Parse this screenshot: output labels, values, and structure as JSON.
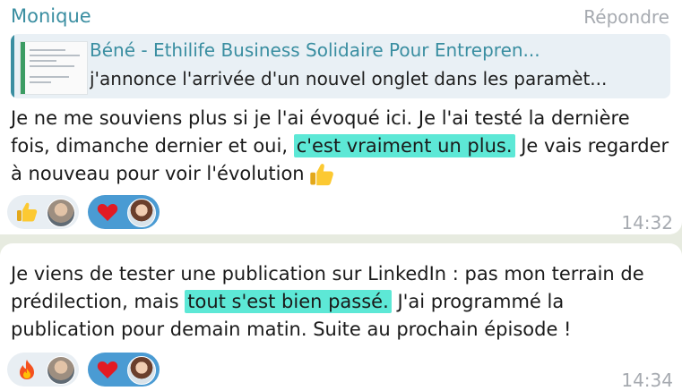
{
  "messages": [
    {
      "author": "Monique",
      "reply_action": "Répondre",
      "quote": {
        "title": "Béné - Ethilife Business Solidaire Pour Entrepren...",
        "text": "j'annonce l'arrivée d'un nouvel onglet dans les paramèt..."
      },
      "text_before": "Je ne me souviens plus si je l'ai évoqué ici. Je l'ai testé la dernière fois, dimanche dernier et oui, ",
      "highlight": "c'est vraiment un plus.",
      "text_after": " Je vais regarder à nouveau pour voir l'évolution",
      "trailing_emoji": "thumbs-up",
      "reactions": [
        {
          "emoji": "thumbs-up",
          "reactor": "man-avatar",
          "mine": false
        },
        {
          "emoji": "red-heart",
          "reactor": "woman-avatar",
          "mine": true
        }
      ],
      "time": "14:32"
    },
    {
      "text_before": "Je viens de tester une publication sur LinkedIn : pas mon terrain de prédilection, mais ",
      "highlight": "tout s'est bien passé.",
      "text_after": " J'ai programmé la publication pour demain matin. Suite au prochain épisode !",
      "reactions": [
        {
          "emoji": "fire",
          "reactor": "man-avatar",
          "mine": false
        },
        {
          "emoji": "red-heart",
          "reactor": "woman-avatar",
          "mine": true
        }
      ],
      "time": "14:34"
    }
  ],
  "colors": {
    "author": "#3a8ea1",
    "highlight": "#5de8d6",
    "my_reaction": "#4a9bd3",
    "reaction": "#e8eef3",
    "chat_background": "#e7ebe0"
  }
}
